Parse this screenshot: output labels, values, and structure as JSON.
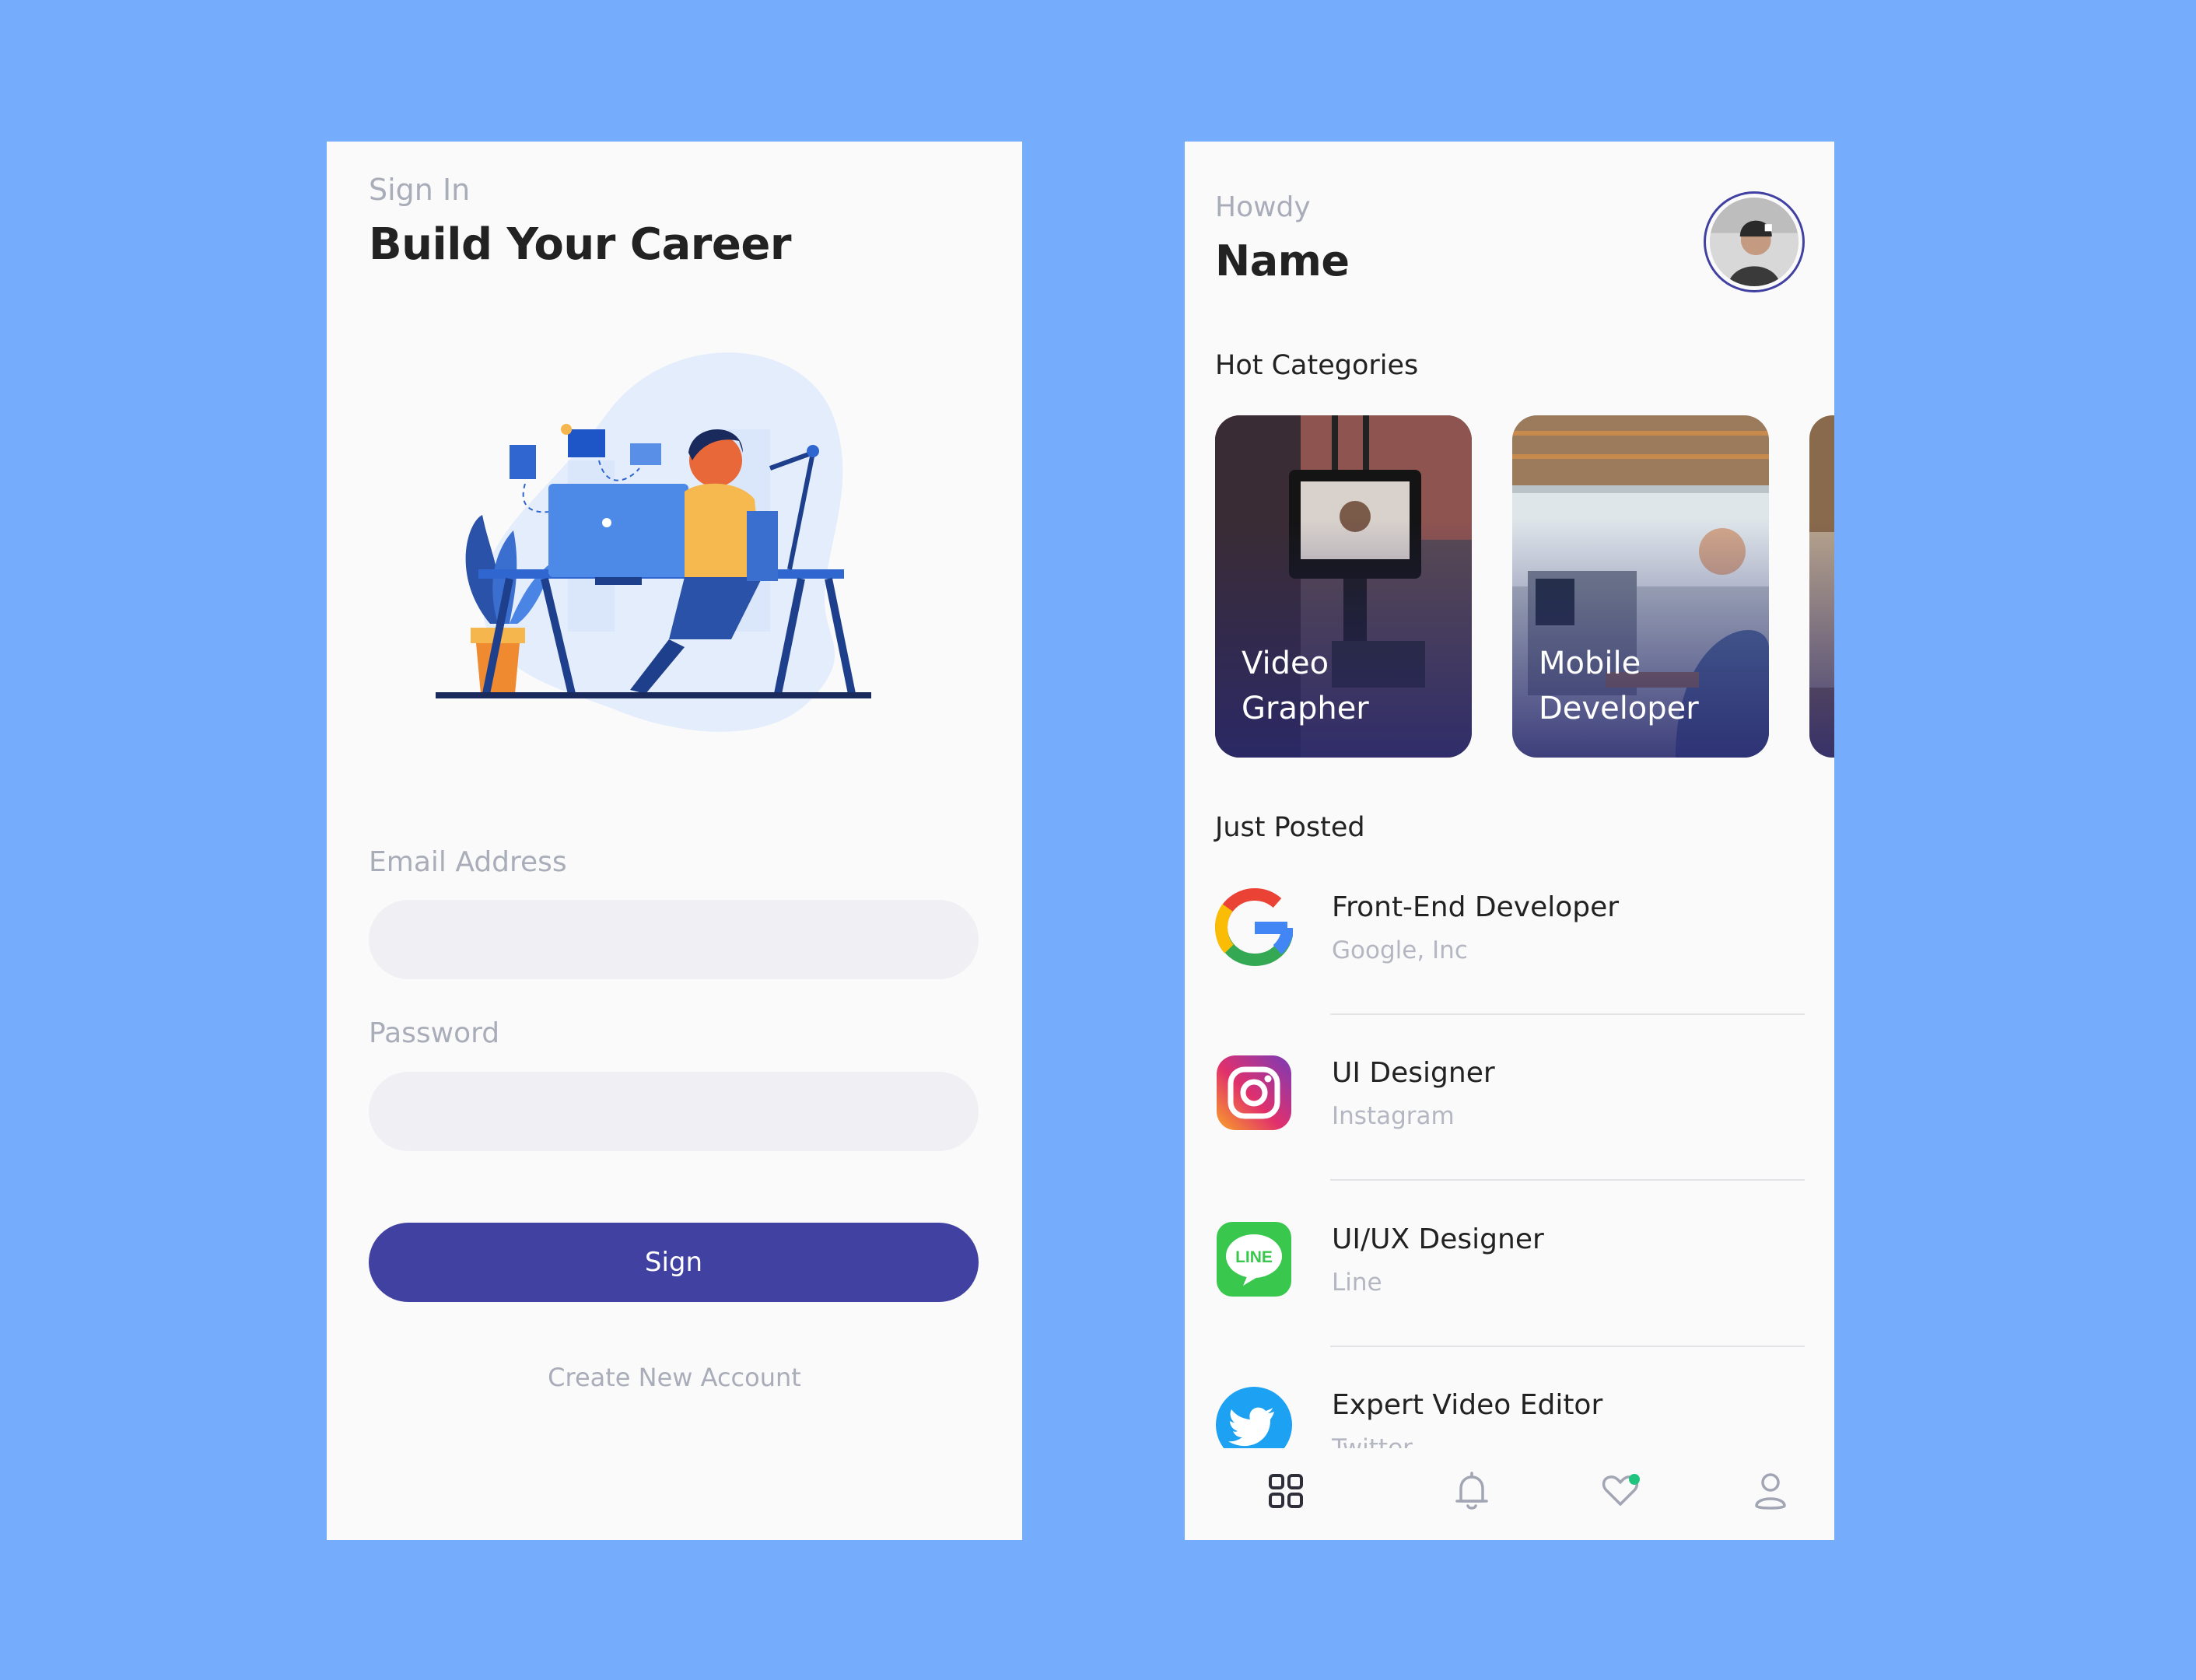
{
  "signin": {
    "eyebrow": "Sign In",
    "title": "Build Your Career",
    "email_label": "Email Address",
    "email_value": "",
    "password_label": "Password",
    "password_value": "",
    "sign_button": "Sign",
    "create_account": "Create New Account"
  },
  "home": {
    "greeting": "Howdy",
    "name": "Name",
    "hot_categories_title": "Hot Categories",
    "categories": [
      {
        "label": "Video Grapher",
        "icon": "video-camera-photo"
      },
      {
        "label": "Mobile Developer",
        "icon": "office-photo"
      }
    ],
    "just_posted_title": "Just Posted",
    "jobs": [
      {
        "title": "Front-End Developer",
        "company": "Google, Inc",
        "icon": "google-logo"
      },
      {
        "title": "UI Designer",
        "company": "Instagram",
        "icon": "instagram-logo"
      },
      {
        "title": "UI/UX Designer",
        "company": "Line",
        "icon": "line-logo"
      },
      {
        "title": "Expert Video Editor",
        "company": "Twitter",
        "icon": "twitter-logo"
      }
    ],
    "line_logo_text": "LINE",
    "nav": [
      {
        "icon": "grid-icon",
        "active": true
      },
      {
        "icon": "bell-icon",
        "active": false
      },
      {
        "icon": "heart-icon",
        "active": false,
        "dot": true
      },
      {
        "icon": "user-icon",
        "active": false
      }
    ]
  },
  "colors": {
    "background": "#76acfc",
    "primary": "#4141a2",
    "notification_dot": "#1fc47e"
  }
}
